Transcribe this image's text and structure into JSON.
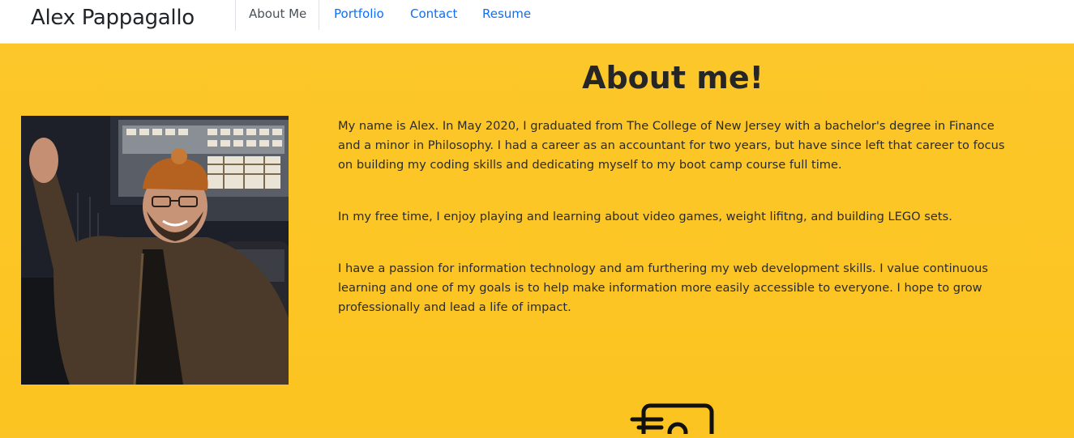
{
  "header": {
    "brand": "Alex Pappagallo",
    "tabs": [
      {
        "label": "About Me",
        "active": true
      },
      {
        "label": "Portfolio",
        "active": false
      },
      {
        "label": "Contact",
        "active": false
      },
      {
        "label": "Resume",
        "active": false
      }
    ]
  },
  "main": {
    "title": "About me!",
    "paragraphs": [
      "My name is Alex. In May 2020, I graduated from The College of New Jersey with a bachelor's degree in Finance and a minor in Philosophy. I had a career as an accountant for two years, but have since left that career to focus on building my coding skills and dedicating myself to my boot camp course full time.",
      "In my free time, I enjoy playing and learning about video games, weight lifitng, and building LEGO sets.",
      "I have a passion for information technology and am furthering my web development skills. I value continuous learning and one of my goals is to help make information more easily accessible to everyone. I hope to grow professionally and lead a life of impact."
    ]
  },
  "colors": {
    "background": "#fcc525",
    "link": "#0d6efd",
    "text": "#262626"
  },
  "icons": [
    "document-icon"
  ]
}
